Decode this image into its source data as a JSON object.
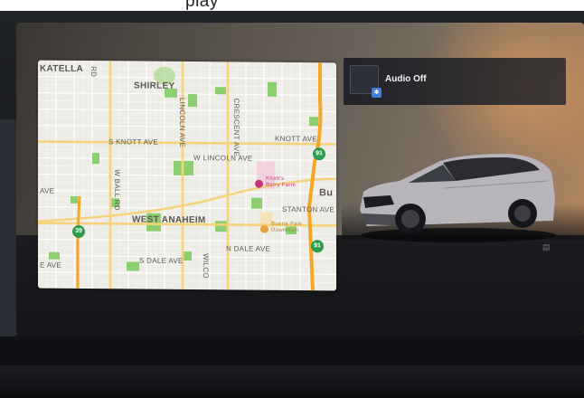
{
  "caption_fragment": "play",
  "map": {
    "city_labels": {
      "katella": "KATELLA",
      "shirley": "SHIRLEY",
      "bu": "Bu",
      "west_anaheim": "WEST ANAHEIM"
    },
    "street_labels": {
      "knott_ave_left": "S KNOTT AVE",
      "knott_ave_right": "KNOTT AVE",
      "w_lincoln": "W LINCOLN AVE",
      "lincoln_vert": "LINCOLN AVE",
      "crescent": "CRESCENT AVE",
      "w_ball": "W BALL RD",
      "stanton": "STANTON AVE",
      "n_dale": "N DALE AVE",
      "s_dale": "S DALE AVE",
      "ave_left": "AVE",
      "ave_bottom_left": "E AVE",
      "wilcox": "WILCO",
      "rd": "RD"
    },
    "route_shields": {
      "r91_top": "91",
      "r91_bottom": "91",
      "r39": "39"
    },
    "pois": {
      "knotts": "Knott's Berry Farm",
      "buena_park": "Buena Park Downtown"
    }
  },
  "audio": {
    "status": "Audio Off",
    "source_icon": "bluetooth-icon"
  },
  "colors": {
    "map_bg": "#eeece6",
    "park_green": "#8ccf70",
    "highway_shield": "#2e9c4e",
    "poi_pink": "#c4357a",
    "poi_orange": "#e6a23c",
    "audio_source_blue": "#3f7fe0"
  }
}
